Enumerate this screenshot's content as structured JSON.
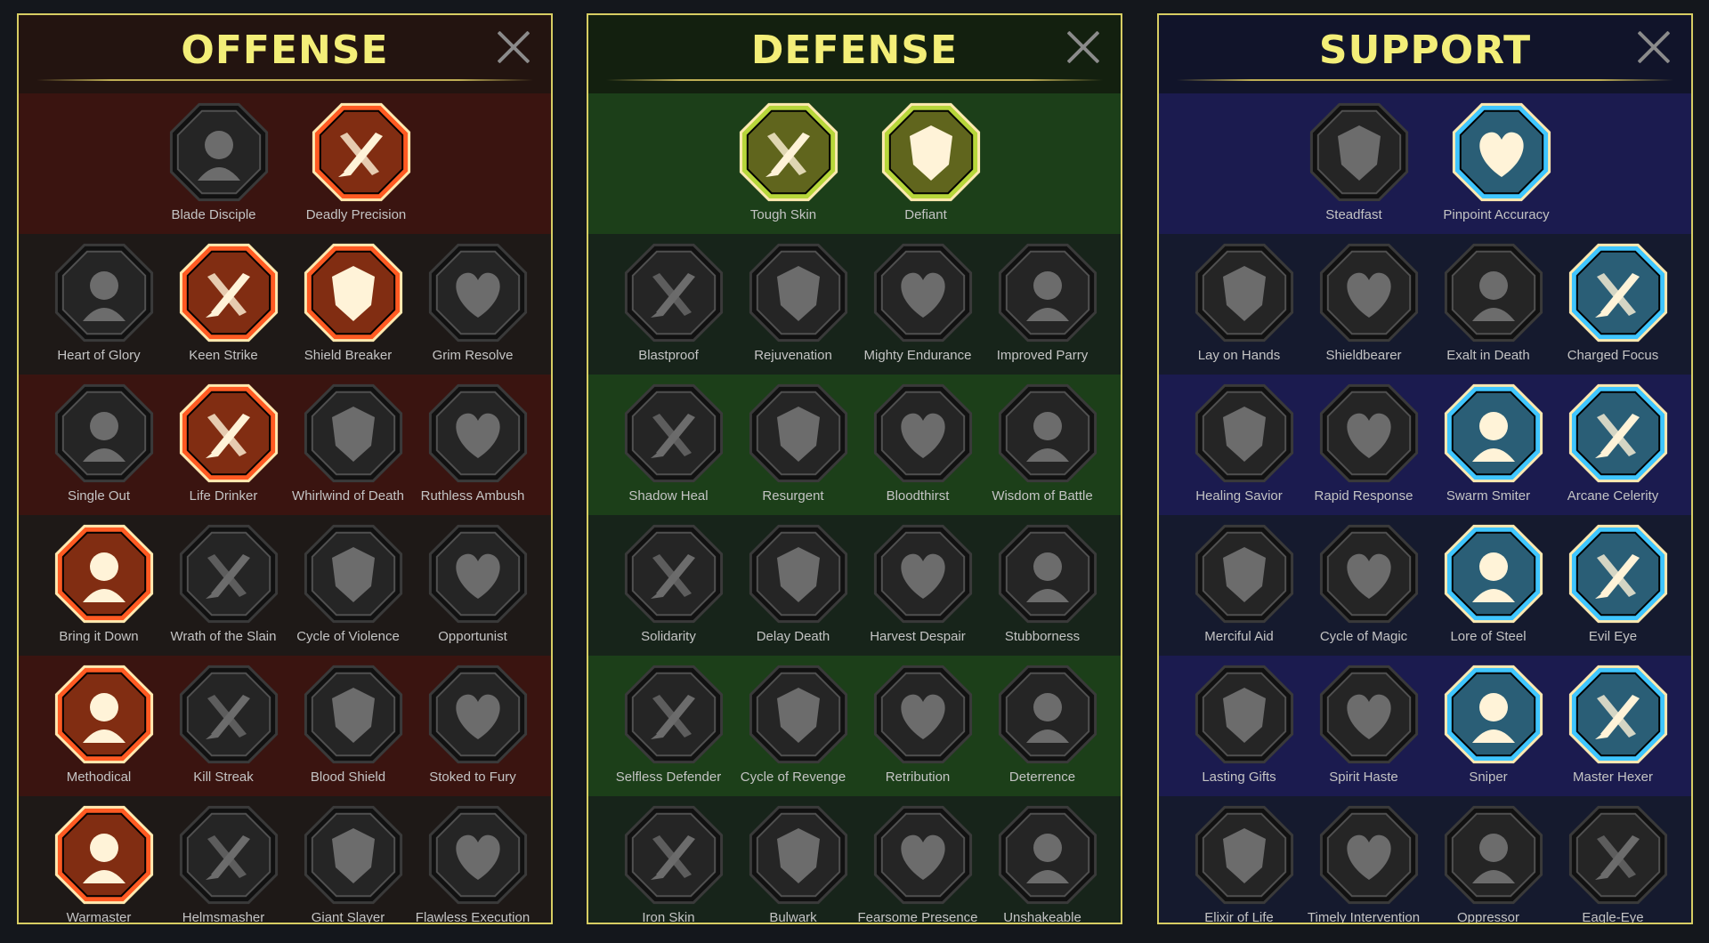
{
  "colors": {
    "offense_active": "#ff5a22",
    "defense_active": "#b7d63a",
    "support_active": "#3fc6ff",
    "inactive_fill": "#242424",
    "title": "#f3ee78"
  },
  "panels": [
    {
      "key": "offense",
      "title": "OFFENSE",
      "rows": [
        [
          {
            "label": "Blade Disciple",
            "icon": "crossed-swords-icon",
            "active": false
          },
          {
            "label": "Deadly Precision",
            "icon": "dagger-strike-icon",
            "active": true
          }
        ],
        [
          {
            "label": "Heart of Glory",
            "icon": "horned-heart-icon",
            "active": false
          },
          {
            "label": "Keen Strike",
            "icon": "sword-slash-icon",
            "active": true
          },
          {
            "label": "Shield Breaker",
            "icon": "broken-shield-icon",
            "active": true
          },
          {
            "label": "Grim Resolve",
            "icon": "spiked-heart-icon",
            "active": false
          }
        ],
        [
          {
            "label": "Single Out",
            "icon": "arrows-target-icon",
            "active": false
          },
          {
            "label": "Life Drinker",
            "icon": "fangs-icon",
            "active": true
          },
          {
            "label": "Whirlwind of Death",
            "icon": "skull-cloak-icon",
            "active": false
          },
          {
            "label": "Ruthless Ambush",
            "icon": "dagger-hand-icon",
            "active": false
          }
        ],
        [
          {
            "label": "Bring it Down",
            "icon": "sword-heart-icon",
            "active": true
          },
          {
            "label": "Wrath of the Slain",
            "icon": "gauntlet-fist-icon",
            "active": false
          },
          {
            "label": "Cycle of Violence",
            "icon": "axe-icon",
            "active": false
          },
          {
            "label": "Opportunist",
            "icon": "chain-lightning-icon",
            "active": false
          }
        ],
        [
          {
            "label": "Methodical",
            "icon": "arrows-bullseye-icon",
            "active": true
          },
          {
            "label": "Kill Streak",
            "icon": "skulls-icon",
            "active": false
          },
          {
            "label": "Blood Shield",
            "icon": "sword-shield-icon",
            "active": false
          },
          {
            "label": "Stoked to Fury",
            "icon": "raging-man-icon",
            "active": false
          }
        ],
        [
          {
            "label": "Warmaster",
            "icon": "sword-sparks-icon",
            "active": true
          },
          {
            "label": "Helmsmasher",
            "icon": "helmet-icon",
            "active": false
          },
          {
            "label": "Giant Slayer",
            "icon": "giant-icon",
            "active": false
          },
          {
            "label": "Flawless Execution",
            "icon": "skull-blade-icon",
            "active": false
          }
        ]
      ]
    },
    {
      "key": "defense",
      "title": "DEFENSE",
      "rows": [
        [
          {
            "label": "Tough Skin",
            "icon": "armor-plates-icon",
            "active": true
          },
          {
            "label": "Defiant",
            "icon": "raised-fist-icon",
            "active": true
          }
        ],
        [
          {
            "label": "Blastproof",
            "icon": "chevron-shield-icon",
            "active": false
          },
          {
            "label": "Rejuvenation",
            "icon": "heart-organ-icon",
            "active": false
          },
          {
            "label": "Mighty Endurance",
            "icon": "armored-warrior-icon",
            "active": false
          },
          {
            "label": "Improved Parry",
            "icon": "crossed-blades-icon",
            "active": false
          }
        ],
        [
          {
            "label": "Shadow Heal",
            "icon": "shadow-figure-icon",
            "active": false
          },
          {
            "label": "Resurgent",
            "icon": "knight-shield-icon",
            "active": false
          },
          {
            "label": "Bloodthirst",
            "icon": "skull-heart-icon",
            "active": false
          },
          {
            "label": "Wisdom of Battle",
            "icon": "monk-icon",
            "active": false
          }
        ],
        [
          {
            "label": "Solidarity",
            "icon": "group-icon",
            "active": false
          },
          {
            "label": "Delay Death",
            "icon": "hourglass-icon",
            "active": false
          },
          {
            "label": "Harvest Despair",
            "icon": "open-hand-icon",
            "active": false
          },
          {
            "label": "Stubborness",
            "icon": "bull-icon",
            "active": false
          }
        ],
        [
          {
            "label": "Selfless Defender",
            "icon": "running-man-icon",
            "active": false
          },
          {
            "label": "Cycle of Revenge",
            "icon": "drops-icon",
            "active": false
          },
          {
            "label": "Retribution",
            "icon": "spiked-skull-icon",
            "active": false
          },
          {
            "label": "Deterrence",
            "icon": "hand-swirl-icon",
            "active": false
          }
        ],
        [
          {
            "label": "Iron Skin",
            "icon": "iron-warrior-icon",
            "active": false
          },
          {
            "label": "Bulwark",
            "icon": "bulwark-shield-icon",
            "active": false
          },
          {
            "label": "Fearsome Presence",
            "icon": "bearded-skull-icon",
            "active": false
          },
          {
            "label": "Unshakeable",
            "icon": "flexing-man-icon",
            "active": false
          }
        ]
      ]
    },
    {
      "key": "support",
      "title": "SUPPORT",
      "rows": [
        [
          {
            "label": "Steadfast",
            "icon": "heart-plus-icon",
            "active": false
          },
          {
            "label": "Pinpoint Accuracy",
            "icon": "target-burst-icon",
            "active": true
          }
        ],
        [
          {
            "label": "Lay on Hands",
            "icon": "praying-hands-icon",
            "active": false
          },
          {
            "label": "Shieldbearer",
            "icon": "radiant-shield-icon",
            "active": false
          },
          {
            "label": "Exalt in Death",
            "icon": "flaming-skull-icon",
            "active": false
          },
          {
            "label": "Charged Focus",
            "icon": "wing-hand-icon",
            "active": true
          }
        ],
        [
          {
            "label": "Healing Savior",
            "icon": "healer-icon",
            "active": false
          },
          {
            "label": "Rapid Response",
            "icon": "lightning-bolt-icon",
            "active": false
          },
          {
            "label": "Swarm Smiter",
            "icon": "zigzag-lightning-icon",
            "active": true
          },
          {
            "label": "Arcane Celerity",
            "icon": "arcane-figure-icon",
            "active": true
          }
        ],
        [
          {
            "label": "Merciful Aid",
            "icon": "chained-heart-icon",
            "active": false
          },
          {
            "label": "Cycle of Magic",
            "icon": "comet-icon",
            "active": false
          },
          {
            "label": "Lore of Steel",
            "icon": "open-book-icon",
            "active": true
          },
          {
            "label": "Evil Eye",
            "icon": "angry-eyes-icon",
            "active": true
          }
        ],
        [
          {
            "label": "Lasting Gifts",
            "icon": "compass-star-icon",
            "active": false
          },
          {
            "label": "Spirit Haste",
            "icon": "winged-boot-icon",
            "active": false
          },
          {
            "label": "Sniper",
            "icon": "eye-icon",
            "active": true
          },
          {
            "label": "Master Hexer",
            "icon": "voodoo-doll-icon",
            "active": true
          }
        ],
        [
          {
            "label": "Elixir of Life",
            "icon": "potion-flask-icon",
            "active": false
          },
          {
            "label": "Timely Intervention",
            "icon": "winged-skull-icon",
            "active": false
          },
          {
            "label": "Oppressor",
            "icon": "crushing-fist-icon",
            "active": false
          },
          {
            "label": "Eagle-Eye",
            "icon": "eagle-icon",
            "active": false
          }
        ]
      ]
    }
  ]
}
